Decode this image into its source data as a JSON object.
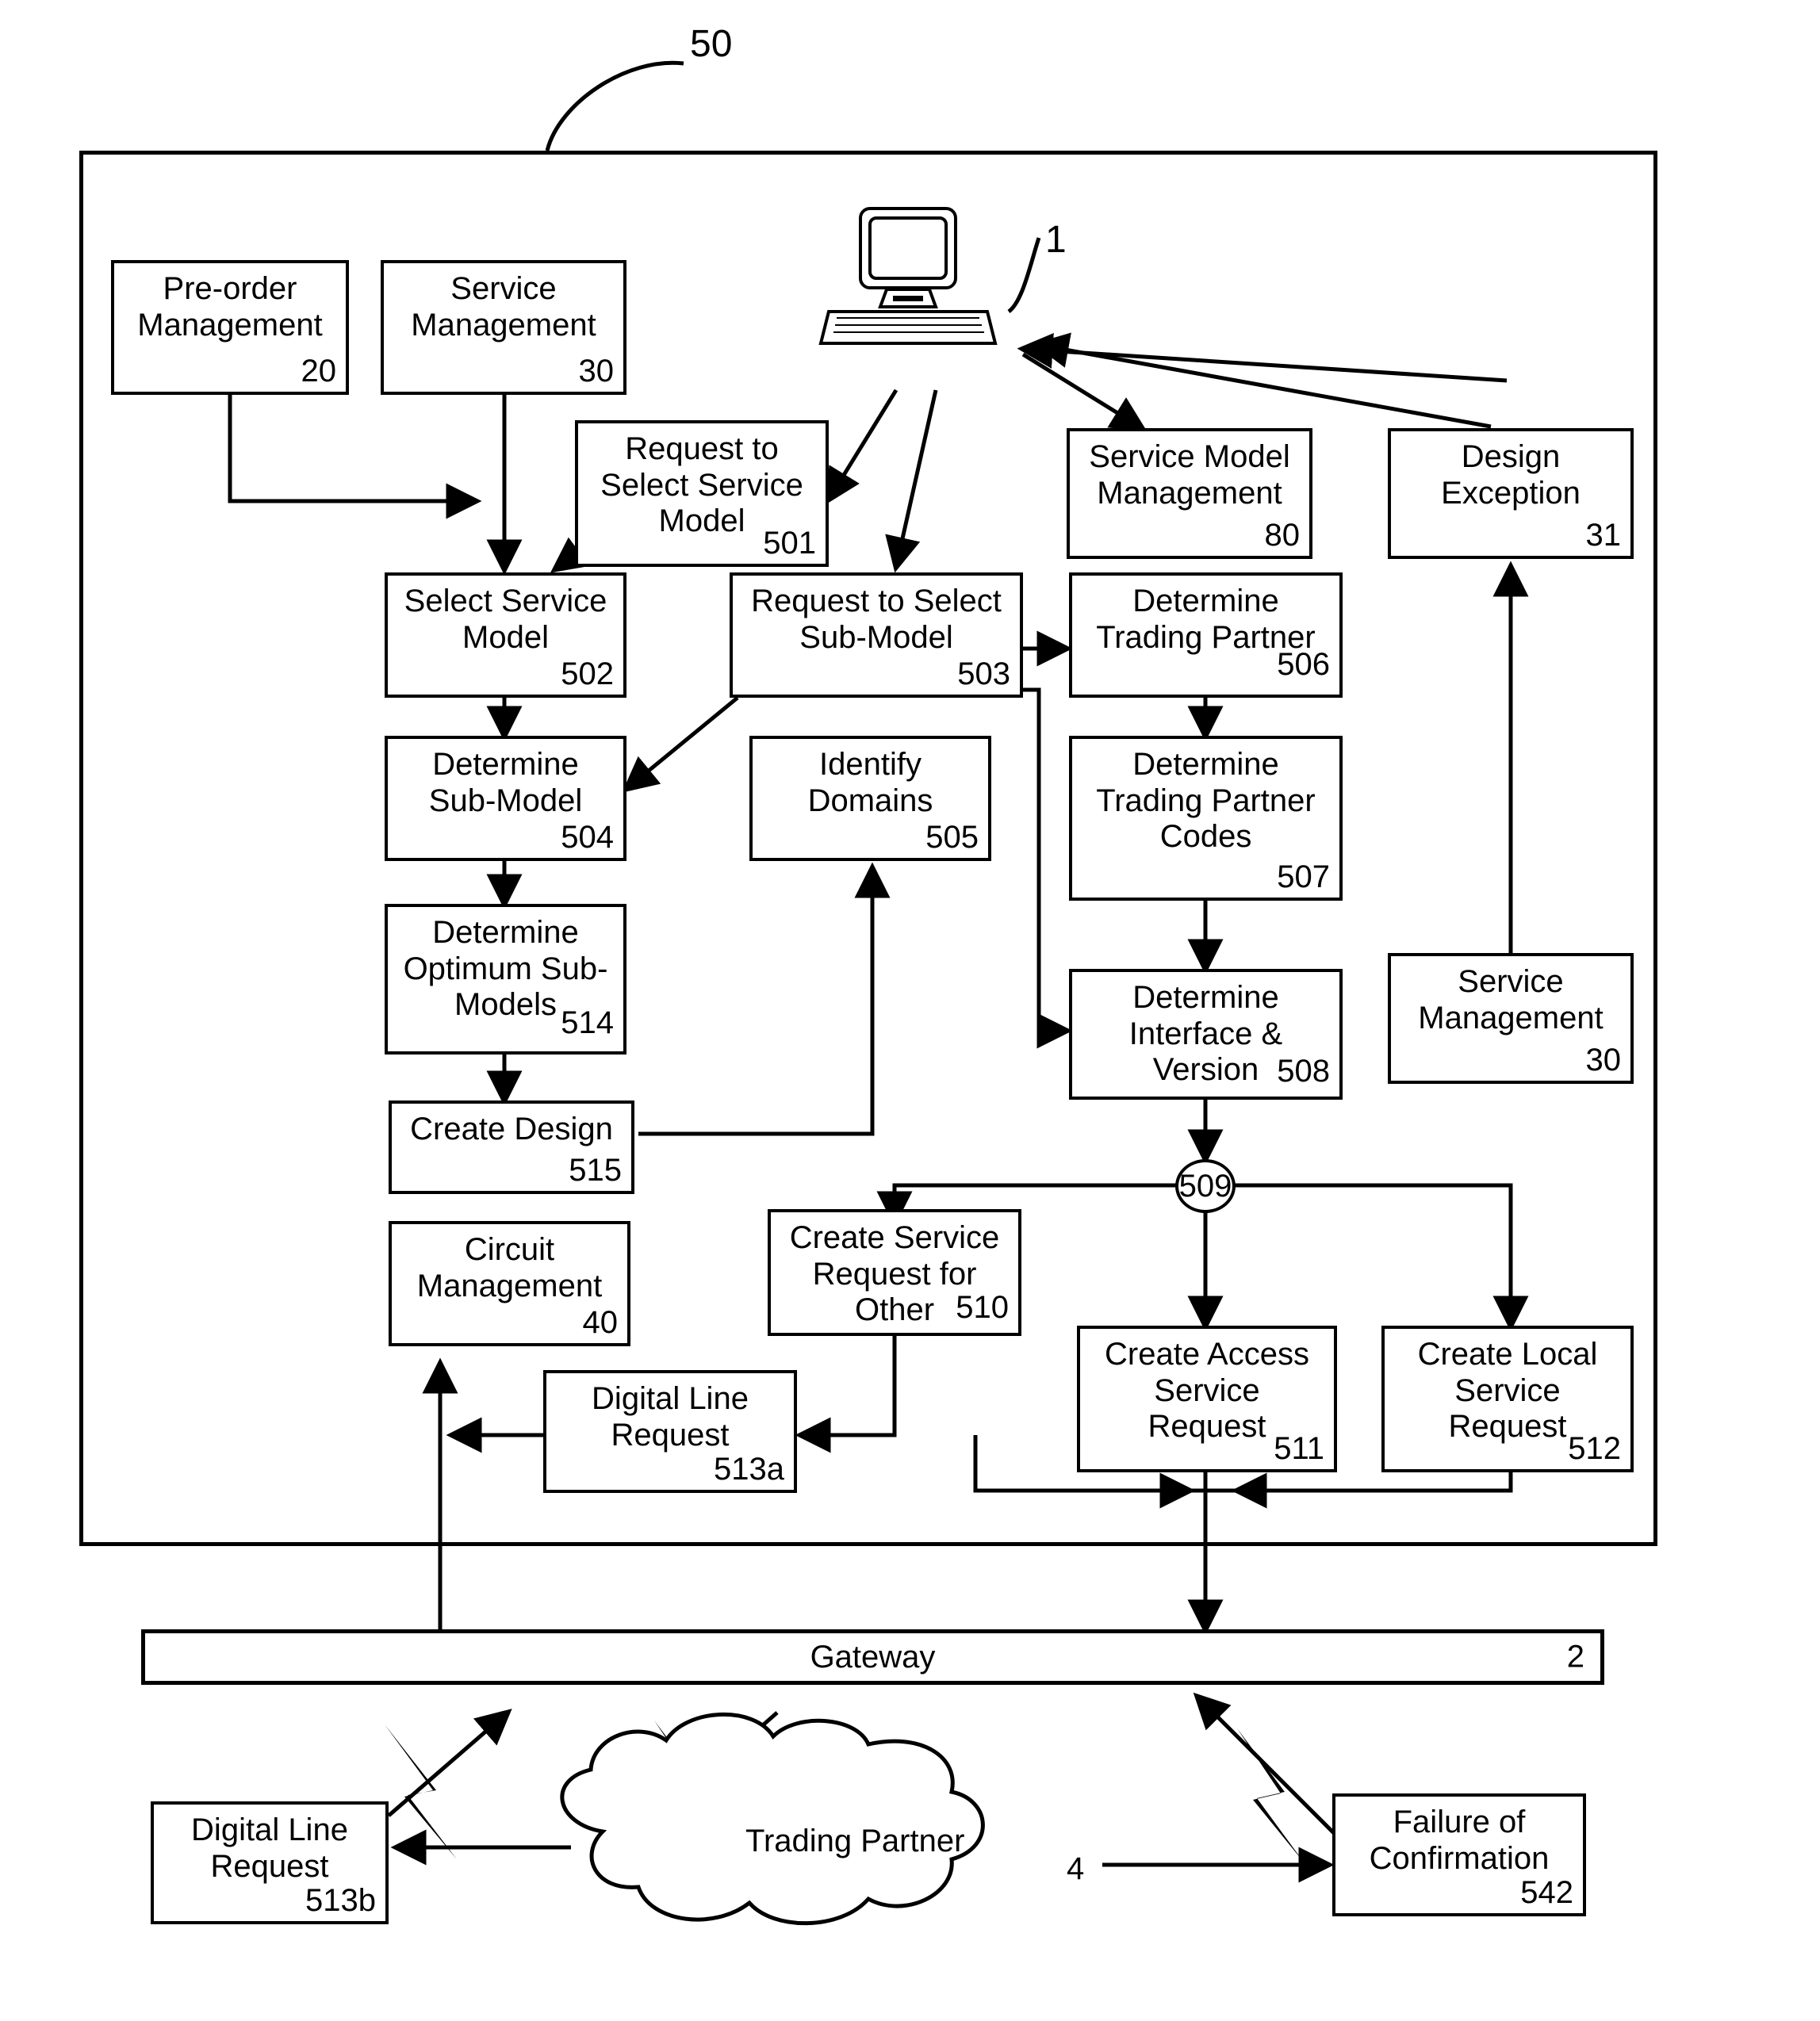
{
  "figure": {
    "system_ref": "50",
    "terminal_ref": "1",
    "gateway": {
      "label": "Gateway",
      "ref": "2"
    },
    "cloud": {
      "label": "Trading Partner",
      "ref": "4"
    }
  },
  "nodes": [
    {
      "id": "preorder-management",
      "label": "Pre-order\nManagement",
      "ref": "20"
    },
    {
      "id": "service-management-top",
      "label": "Service\nManagement",
      "ref": "30"
    },
    {
      "id": "request-select-service-model",
      "label": "Request to\nSelect Service\nModel",
      "ref": "501"
    },
    {
      "id": "service-model-management",
      "label": "Service Model\nManagement",
      "ref": "80"
    },
    {
      "id": "design-exception",
      "label": "Design\nException",
      "ref": "31"
    },
    {
      "id": "select-service-model",
      "label": "Select Service\nModel",
      "ref": "502"
    },
    {
      "id": "request-select-sub-model",
      "label": "Request to Select\nSub-Model",
      "ref": "503"
    },
    {
      "id": "determine-trading-partner",
      "label": "Determine\nTrading Partner",
      "ref": "506"
    },
    {
      "id": "determine-sub-model",
      "label": "Determine\nSub-Model",
      "ref": "504"
    },
    {
      "id": "identify-domains",
      "label": "Identify\nDomains",
      "ref": "505"
    },
    {
      "id": "determine-trading-partner-codes",
      "label": "Determine\nTrading Partner\nCodes",
      "ref": "507"
    },
    {
      "id": "determine-optimum-sub-models",
      "label": "Determine\nOptimum Sub-\nModels",
      "ref": "514"
    },
    {
      "id": "determine-interface-version",
      "label": "Determine\nInterface &\nVersion",
      "ref": "508"
    },
    {
      "id": "service-management-right",
      "label": "Service\nManagement",
      "ref": "30"
    },
    {
      "id": "create-design",
      "label": "Create Design",
      "ref": "515"
    },
    {
      "id": "junction",
      "label": "509"
    },
    {
      "id": "circuit-management",
      "label": "Circuit\nManagement",
      "ref": "40"
    },
    {
      "id": "create-service-request-other",
      "label": "Create Service\nRequest for\nOther",
      "ref": "510"
    },
    {
      "id": "create-access-service-request",
      "label": "Create Access\nService\nRequest",
      "ref": "511"
    },
    {
      "id": "create-local-service-request",
      "label": "Create Local\nService\nRequest",
      "ref": "512"
    },
    {
      "id": "digital-line-request-a",
      "label": "Digital Line\nRequest",
      "ref": "513a"
    },
    {
      "id": "digital-line-request-b",
      "label": "Digital Line\nRequest",
      "ref": "513b"
    },
    {
      "id": "failure-of-confirmation",
      "label": "Failure of\nConfirmation",
      "ref": "542"
    }
  ]
}
